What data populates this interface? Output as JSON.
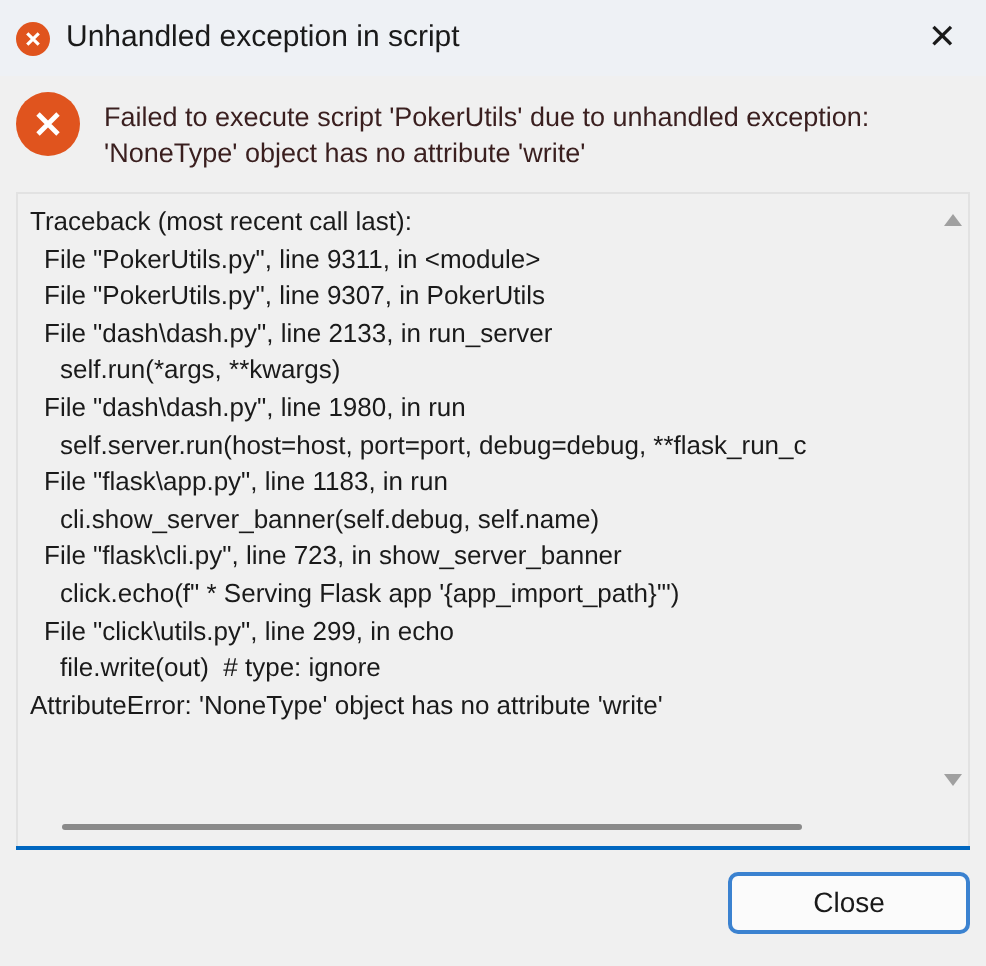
{
  "window": {
    "title": "Unhandled exception in script",
    "close_glyph": "✕"
  },
  "message": [
    "Failed to execute script 'PokerUtils' due to unhandled exception:",
    "'NoneType' object has no attribute 'write'"
  ],
  "traceback": [
    {
      "kind": "header",
      "text": "Traceback (most recent call last):"
    },
    {
      "kind": "frame",
      "text": "File \"PokerUtils.py\", line 9311, in <module>"
    },
    {
      "kind": "frame",
      "text": "File \"PokerUtils.py\", line 9307, in PokerUtils"
    },
    {
      "kind": "frame",
      "text": "File \"dash\\dash.py\", line 2133, in run_server"
    },
    {
      "kind": "code",
      "text": "self.run(*args, **kwargs)"
    },
    {
      "kind": "frame",
      "text": "File \"dash\\dash.py\", line 1980, in run"
    },
    {
      "kind": "code",
      "text": "self.server.run(host=host, port=port, debug=debug, **flask_run_c"
    },
    {
      "kind": "frame",
      "text": "File \"flask\\app.py\", line 1183, in run"
    },
    {
      "kind": "code",
      "text": "cli.show_server_banner(self.debug, self.name)"
    },
    {
      "kind": "frame",
      "text": "File \"flask\\cli.py\", line 723, in show_server_banner"
    },
    {
      "kind": "code",
      "text": "click.echo(f\" * Serving Flask app '{app_import_path}'\")"
    },
    {
      "kind": "frame",
      "text": "File \"click\\utils.py\", line 299, in echo"
    },
    {
      "kind": "code",
      "text": "file.write(out)  # type: ignore"
    },
    {
      "kind": "error",
      "text": "AttributeError: 'NoneType' object has no attribute 'write'"
    }
  ],
  "buttons": [
    {
      "label": "Close"
    }
  ]
}
